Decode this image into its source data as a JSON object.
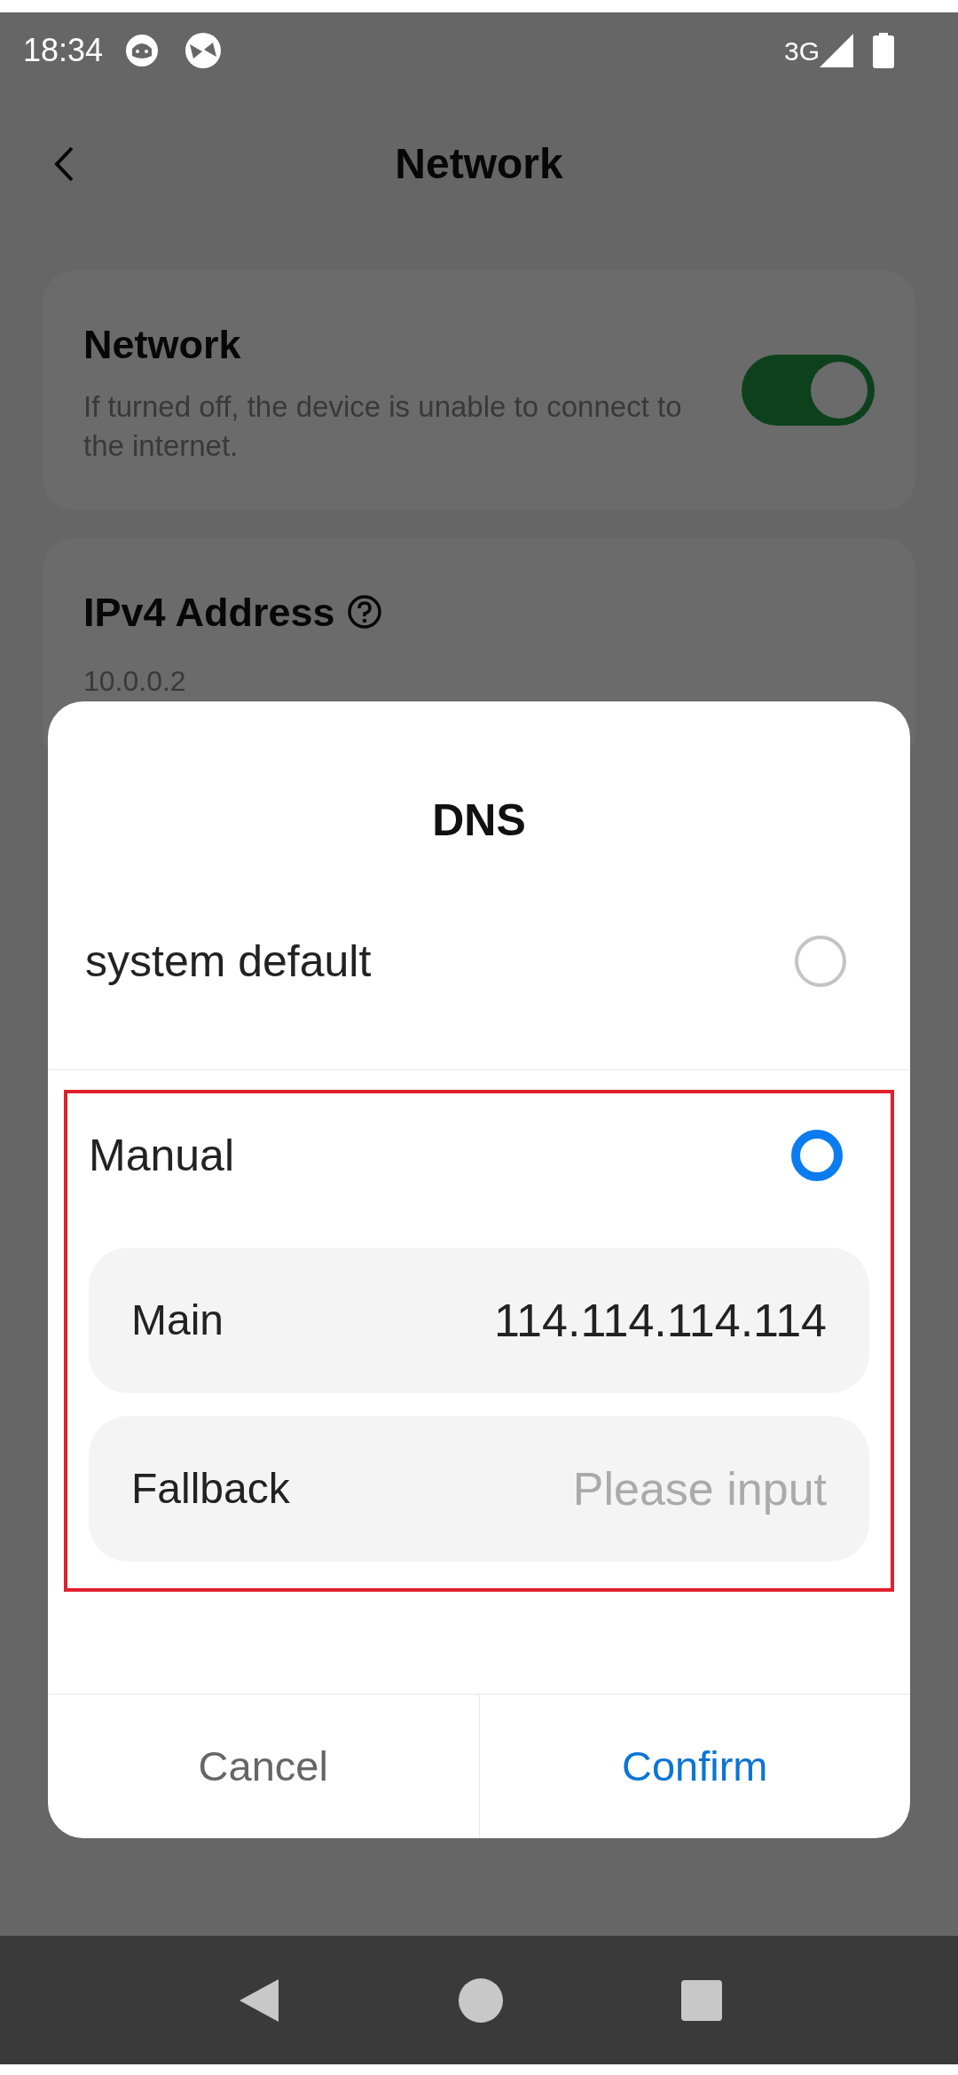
{
  "status_bar": {
    "time": "18:34",
    "network": "3G"
  },
  "header": {
    "title": "Network"
  },
  "network_card": {
    "title": "Network",
    "description": "If turned off, the device is unable to connect to the internet.",
    "on": true
  },
  "ipv4_card": {
    "title": "IPv4 Address",
    "value": "10.0.0.2"
  },
  "dialog": {
    "title": "DNS",
    "options": [
      {
        "label": "system default",
        "selected": false,
        "highlighted": false
      },
      {
        "label": "Manual",
        "selected": true,
        "highlighted": true
      }
    ],
    "fields": [
      {
        "label": "Main",
        "value": "114.114.114.114"
      },
      {
        "label": "Fallback",
        "placeholder": "Please input"
      }
    ],
    "buttons": [
      {
        "label": "Cancel",
        "kind": "secondary"
      },
      {
        "label": "Confirm",
        "kind": "primary"
      }
    ]
  }
}
